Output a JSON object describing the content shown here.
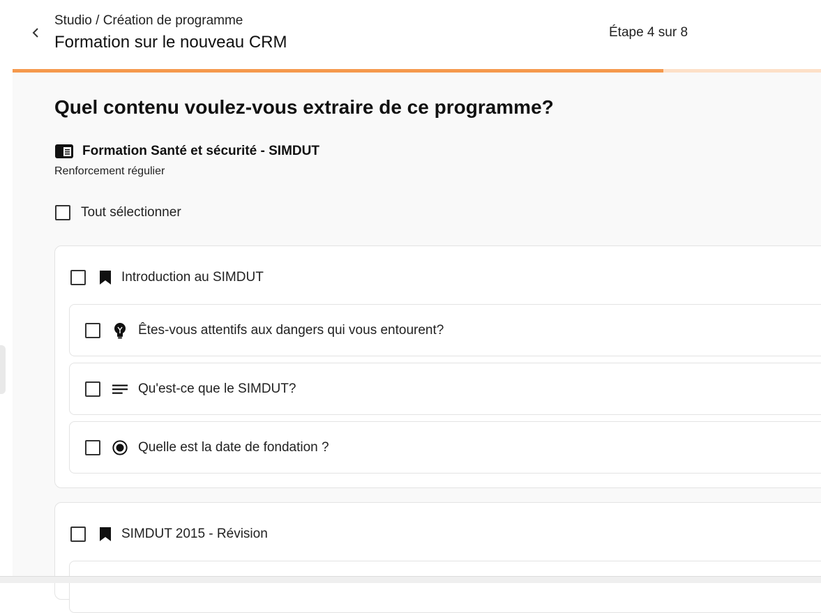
{
  "header": {
    "breadcrumb": "Studio / Création de programme",
    "title": "Formation sur le nouveau CRM",
    "step_label": "Étape 4 sur 8",
    "back_icon": "chevron-left-icon"
  },
  "progress": {
    "current_step": 4,
    "total_steps": 8,
    "fraction": 0.5,
    "color": "#f5994d",
    "track_color": "#fde0c8"
  },
  "main": {
    "question": "Quel contenu voulez-vous extraire de ce programme?",
    "program": {
      "icon": "program-book-icon",
      "name": "Formation Santé et sécurité - SIMDUT",
      "subtitle": "Renforcement régulier"
    },
    "select_all_label": "Tout sélectionner",
    "modules": [
      {
        "title": "Introduction au SIMDUT",
        "icon": "bookmark-icon",
        "items": [
          {
            "label": "Êtes-vous attentifs aux dangers qui vous entourent?",
            "icon": "lightbulb-icon"
          },
          {
            "label": "Qu'est-ce que le SIMDUT?",
            "icon": "text-lines-icon"
          },
          {
            "label": "Quelle est la date de fondation ?",
            "icon": "radio-question-icon"
          }
        ]
      },
      {
        "title": "SIMDUT 2015 - Révision",
        "icon": "bookmark-icon",
        "items": []
      }
    ]
  }
}
